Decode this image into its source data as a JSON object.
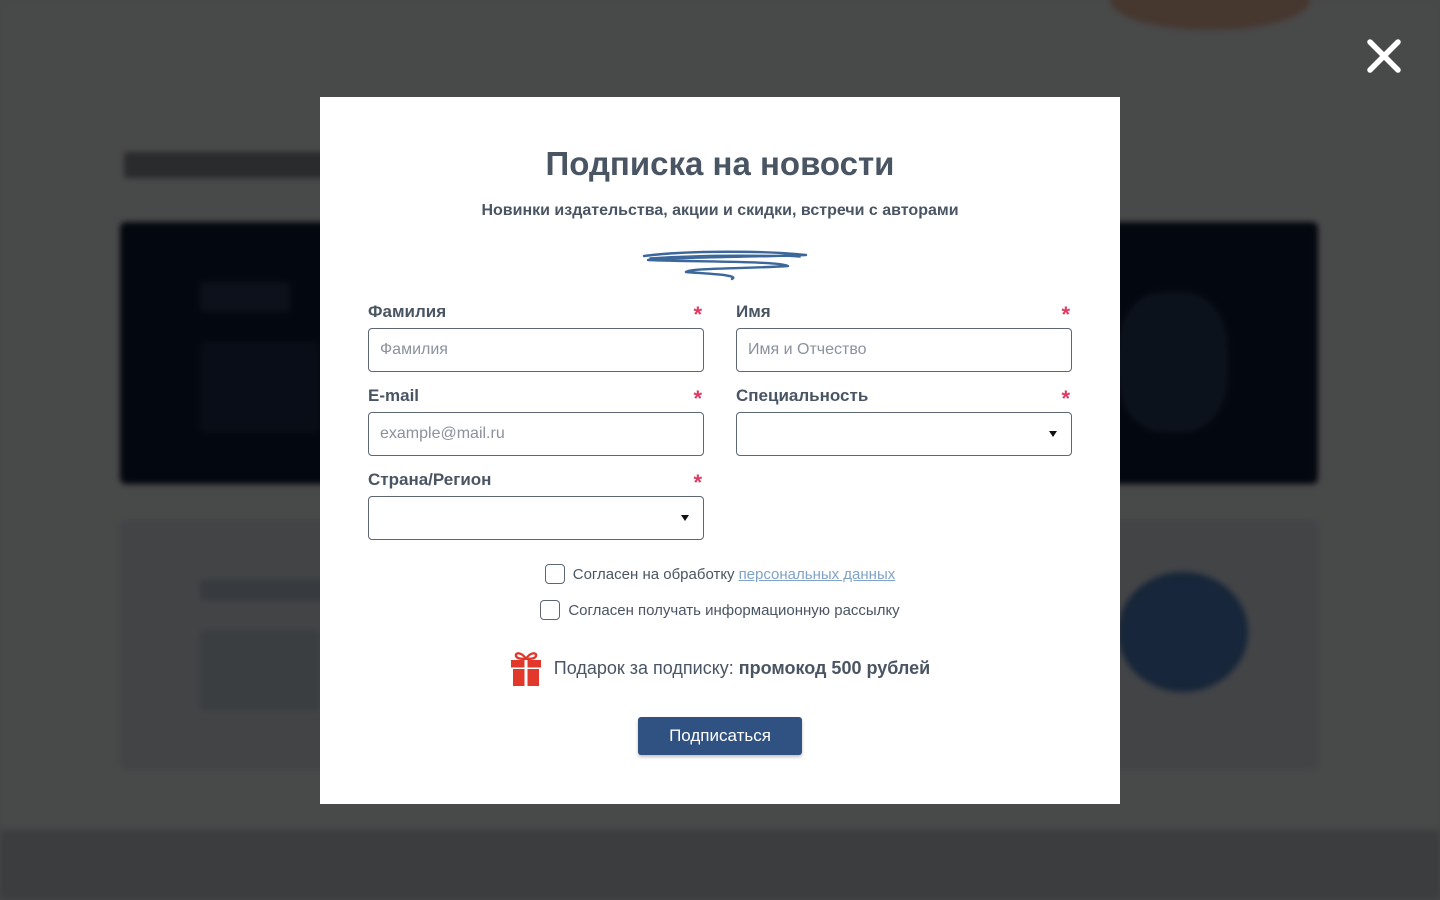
{
  "modal": {
    "title": "Подписка на новости",
    "subtitle": "Новинки издательства, акции и скидки, встречи с авторами"
  },
  "form": {
    "required_mark": "*",
    "lastname": {
      "label": "Фамилия",
      "placeholder": "Фамилия",
      "value": ""
    },
    "firstname": {
      "label": "Имя",
      "placeholder": "Имя и Отчество",
      "value": ""
    },
    "email": {
      "label": "E-mail",
      "placeholder": "example@mail.ru",
      "value": ""
    },
    "specialty": {
      "label": "Специальность",
      "selected": ""
    },
    "region": {
      "label": "Страна/Регион",
      "selected": ""
    }
  },
  "consents": {
    "personal_data_text": "Согласен на обработку",
    "personal_data_link": "персональных данных",
    "personal_data_checked": false,
    "newsletter_text": "Согласен получать информационную рассылку",
    "newsletter_checked": false
  },
  "gift": {
    "text": "Подарок за подписку:",
    "bold": "промокод 500 рублей"
  },
  "submit_label": "Подписаться",
  "icons": {
    "close": "close-icon",
    "gift": "gift-icon",
    "dropdown": "chevron-down-icon"
  },
  "colors": {
    "button": "#2f5282",
    "required": "#e0395f",
    "link": "#7fa3c9",
    "gift": "#e2382c",
    "text": "#4a5563"
  }
}
